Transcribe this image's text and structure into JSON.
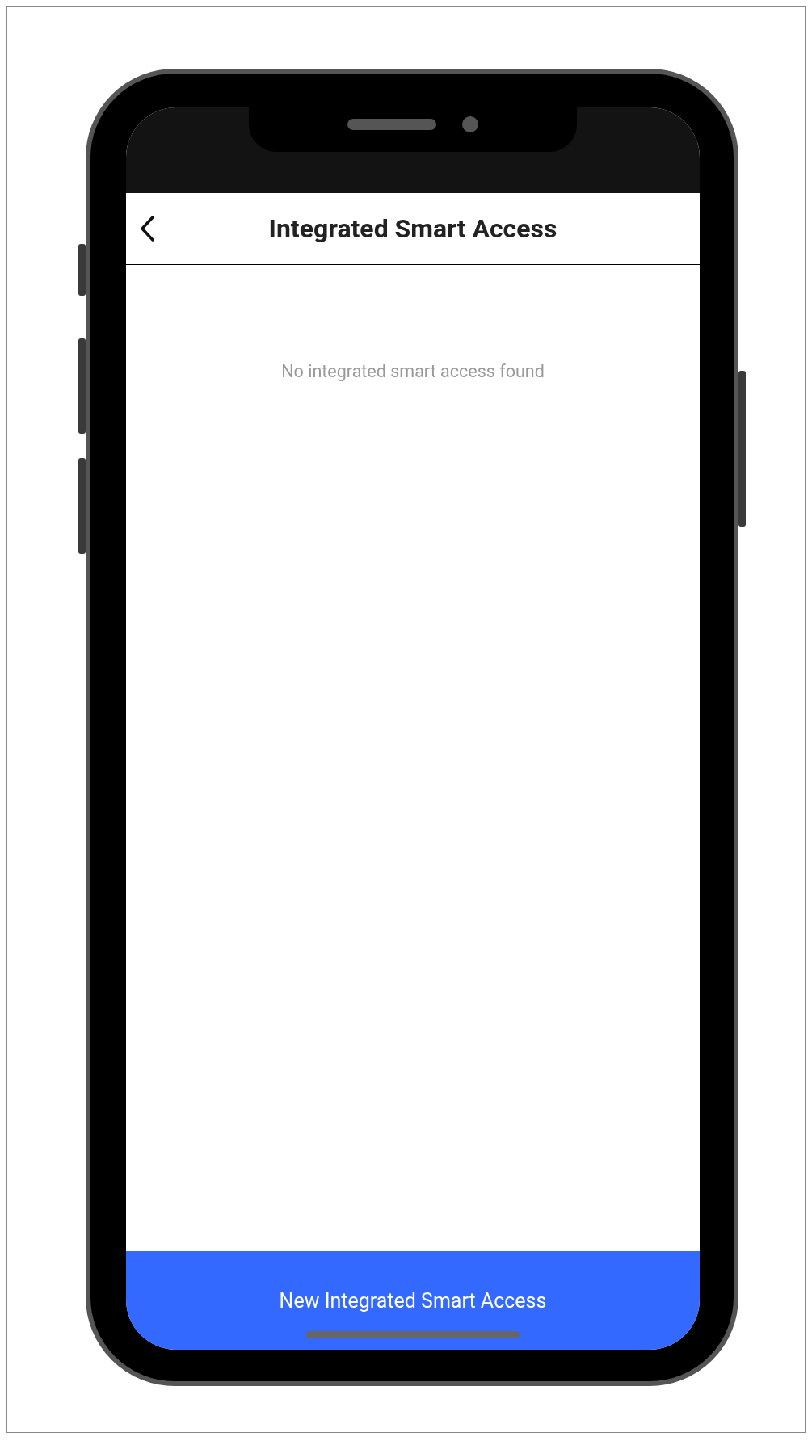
{
  "header": {
    "title": "Integrated Smart Access"
  },
  "empty_message": "No integrated smart access found",
  "primary_button": {
    "label": "New Integrated Smart Access"
  }
}
